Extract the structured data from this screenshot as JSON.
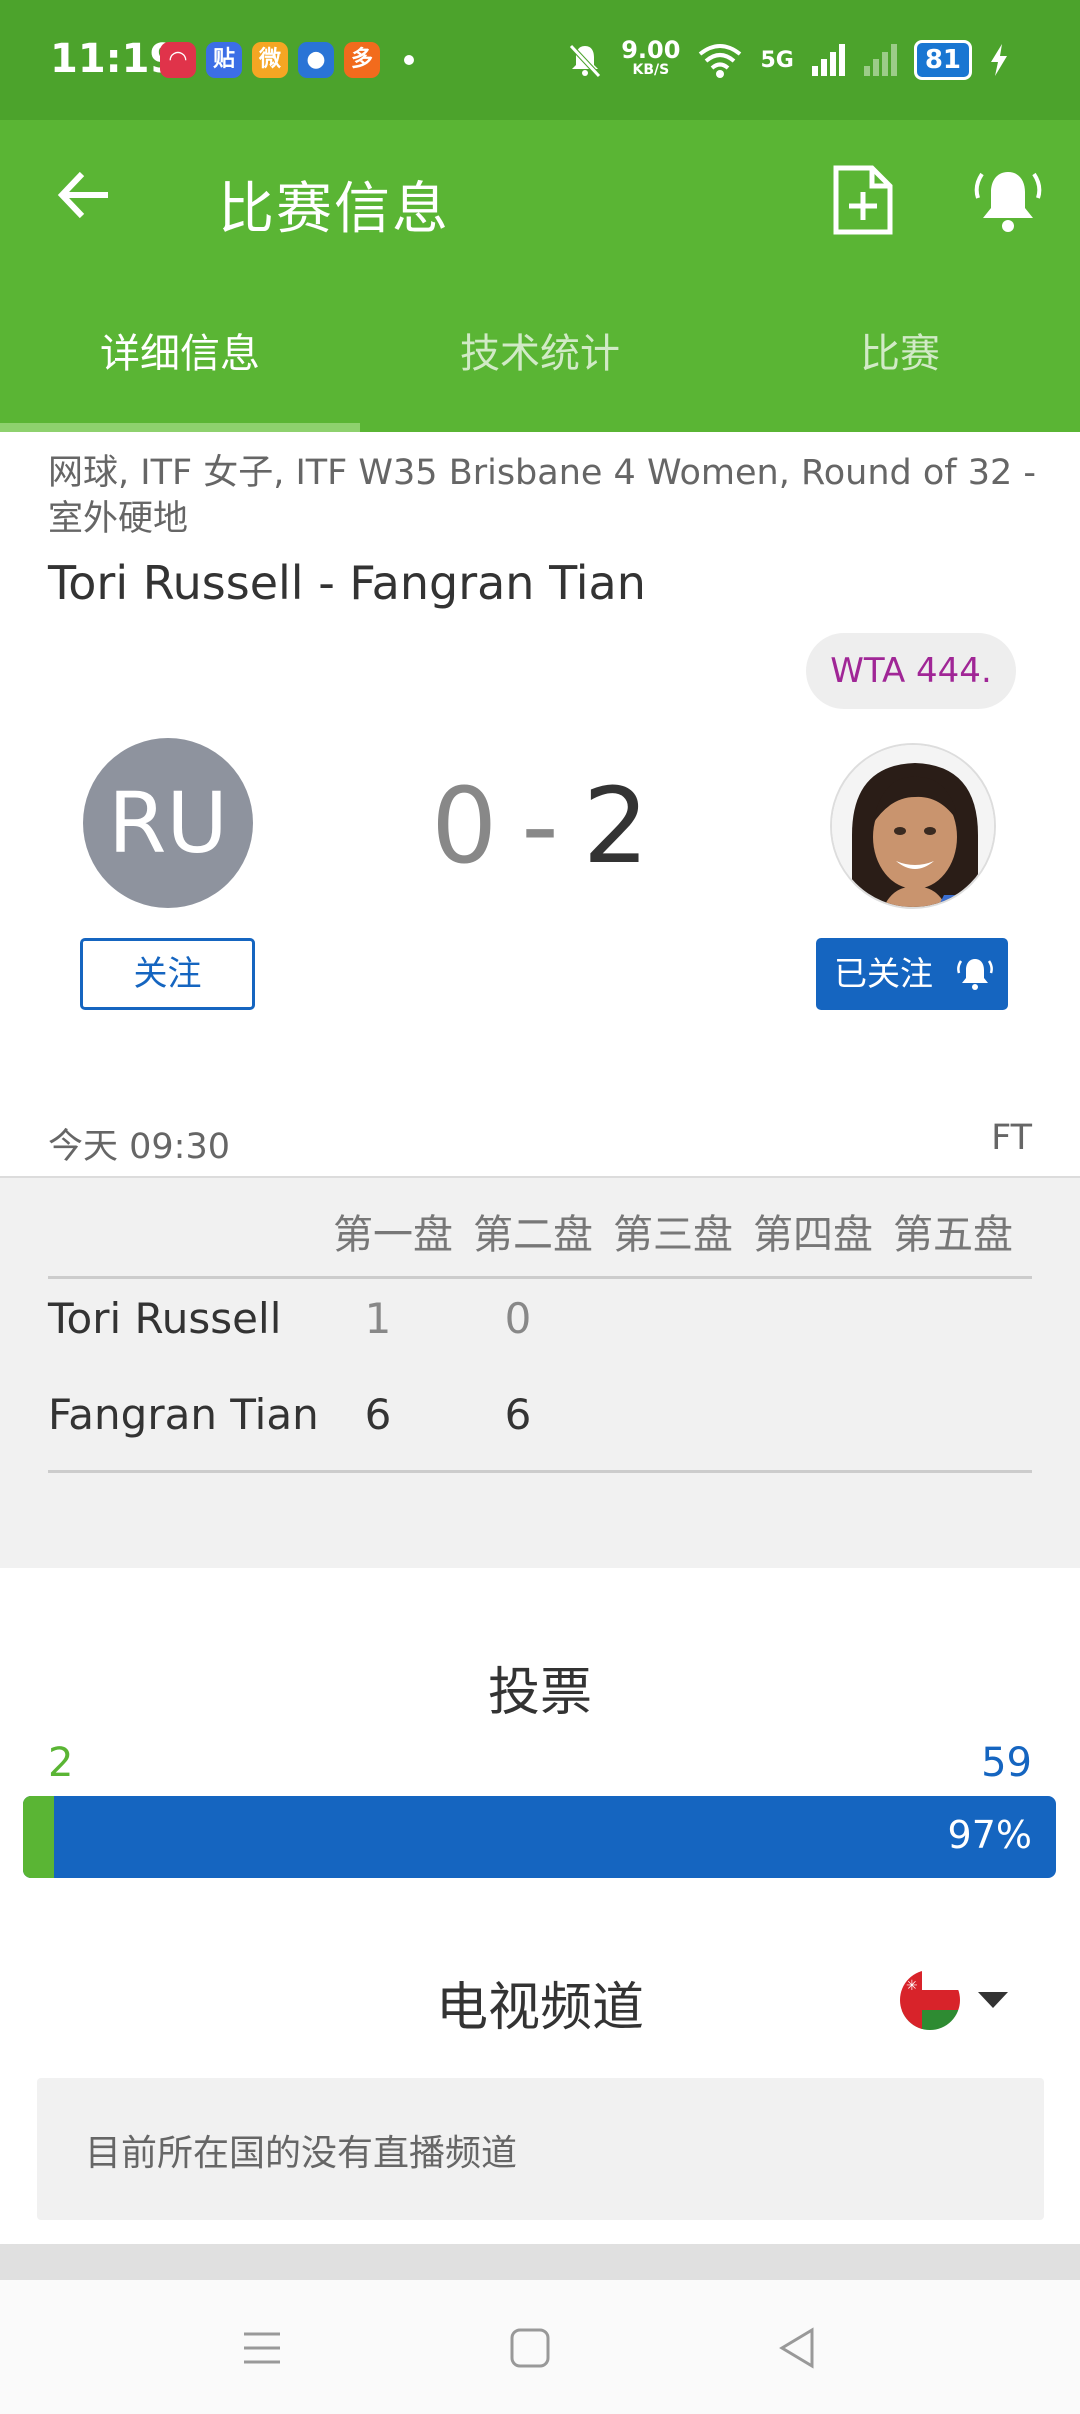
{
  "status_bar": {
    "time": "11:19",
    "apps": [
      {
        "icon": "app-red-icon",
        "glyph": "◠",
        "color": "#e0334a"
      },
      {
        "icon": "tieba-icon",
        "glyph": "贴",
        "color": "#3c6ee6"
      },
      {
        "icon": "weibo-icon",
        "glyph": "微",
        "color": "#f5a623"
      },
      {
        "icon": "app-blue-icon",
        "glyph": "●",
        "color": "#2a74d6"
      },
      {
        "icon": "app-orange-icon",
        "glyph": "多",
        "color": "#f26b1d"
      }
    ],
    "speed_value": "9.00",
    "speed_unit": "KB/S",
    "network": "5G",
    "battery": "81"
  },
  "app_bar": {
    "title": "比赛信息"
  },
  "tabs": [
    {
      "label": "详细信息",
      "active": true
    },
    {
      "label": "技术统计",
      "active": false
    },
    {
      "label": "比赛",
      "active": false
    }
  ],
  "match": {
    "meta": "网球, ITF 女子, ITF W35 Brisbane 4 Women, Round of 32 - 室外硬地",
    "title": "Tori Russell - Fangran Tian",
    "rank_badge": "WTA 444.",
    "home_initials": "RU",
    "score_home": "0",
    "score_sep": "-",
    "score_away": "2",
    "follow_label": "关注",
    "followed_label": "已关注",
    "time": "今天 09:30",
    "status": "FT"
  },
  "sets": {
    "headers": [
      "第一盘",
      "第二盘",
      "第三盘",
      "第四盘",
      "第五盘"
    ],
    "rows": [
      {
        "name": "Tori Russell",
        "scores": [
          "1",
          "0"
        ]
      },
      {
        "name": "Fangran Tian",
        "scores": [
          "6",
          "6"
        ]
      }
    ]
  },
  "votes": {
    "title": "投票",
    "home_votes": "2",
    "away_votes": "59",
    "away_percent_label": "97%",
    "home_share": 0.03,
    "colors": {
      "home": "#5ab534",
      "away": "#1565c0"
    }
  },
  "tv": {
    "title": "电视频道",
    "empty_message": "目前所在国的没有直播频道",
    "country_flag": "oman-flag-icon"
  },
  "theme": {
    "status_bar": "#4ca32c",
    "app_bar": "#5ab534",
    "accent_blue": "#1565c0",
    "rank_text": "#a02696"
  }
}
